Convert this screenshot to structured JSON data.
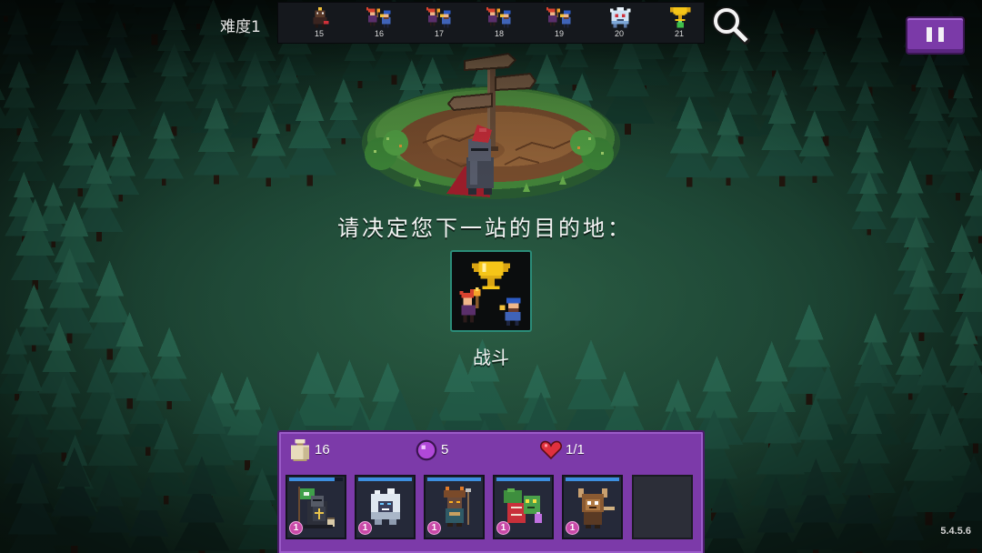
{
  "header": {
    "difficulty_label": "难度1",
    "stages": [
      {
        "number": "15",
        "icon": "single-enemy-icon"
      },
      {
        "number": "16",
        "icon": "duel-icon"
      },
      {
        "number": "17",
        "icon": "duel-icon"
      },
      {
        "number": "18",
        "icon": "duel-icon"
      },
      {
        "number": "19",
        "icon": "duel-icon"
      },
      {
        "number": "20",
        "icon": "boss-icon"
      },
      {
        "number": "21",
        "icon": "trophy-icon"
      }
    ],
    "search_icon": "magnifier-icon",
    "pause_icon": "pause-icon"
  },
  "scene": {
    "icon": "signpost-clearing",
    "hero_icon": "knight-icon"
  },
  "prompt": "请决定您下一站的目的地：",
  "destination": {
    "label": "战斗",
    "icon": "trophy-duel-icon"
  },
  "panel": {
    "stats": {
      "bag": "16",
      "bag_icon": "bag-icon",
      "orbs": "5",
      "orb_icon": "purple-orb-icon",
      "hearts": "1/1",
      "heart_icon": "heart-icon"
    },
    "units": [
      {
        "icon": "flag-knight-icon",
        "level": "1",
        "hp": 0.85
      },
      {
        "icon": "white-yeti-icon",
        "level": "1",
        "hp": 1
      },
      {
        "icon": "tribal-warrior-icon",
        "level": "1",
        "hp": 1
      },
      {
        "icon": "goblin-crate-icon",
        "level": "1",
        "hp": 1
      },
      {
        "icon": "horned-beast-icon",
        "level": "1",
        "hp": 1
      },
      {
        "empty": true
      }
    ]
  },
  "version": "5.4.5.6",
  "colors": {
    "panel_purple": "#7c3aa9",
    "pause_purple": "#7b3aa8",
    "card_border": "#2b8c78",
    "hp_blue": "#3d8fe0",
    "level_badge": "#c94aa8"
  }
}
